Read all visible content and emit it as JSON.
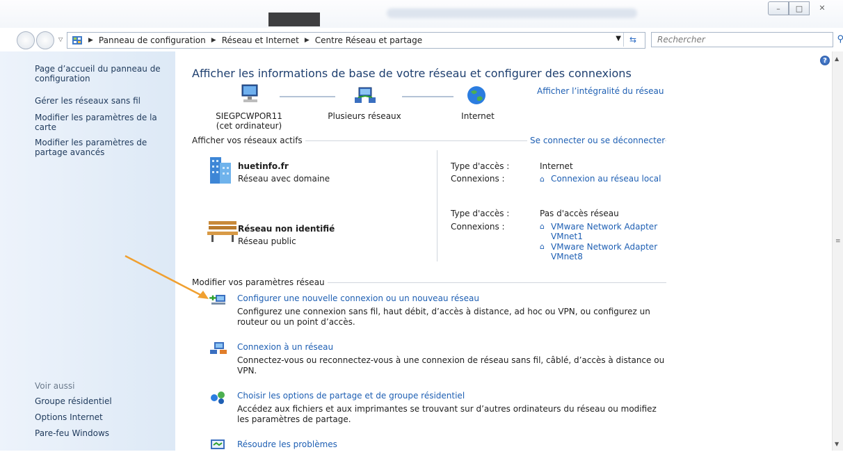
{
  "window": {
    "min_label": "–",
    "max_label": "□",
    "close_label": "✕"
  },
  "address": {
    "crumbs": [
      "Panneau de configuration",
      "Réseau et Internet",
      "Centre Réseau et partage"
    ],
    "search_placeholder": "Rechercher"
  },
  "sidebar": {
    "links": [
      "Page d’accueil du panneau de configuration",
      "Gérer les réseaux sans fil",
      "Modifier les paramètres de la carte",
      "Modifier les paramètres de partage avancés"
    ],
    "see_also_title": "Voir aussi",
    "see_also": [
      "Groupe résidentiel",
      "Options Internet",
      "Pare-feu Windows"
    ]
  },
  "main": {
    "heading": "Afficher les informations de base de votre réseau et configurer des connexions",
    "full_map_link": "Afficher l’intégralité du réseau",
    "map": {
      "computer": "SIEGPCWPOR11",
      "computer_sub": "(cet ordinateur)",
      "middle": "Plusieurs réseaux",
      "internet": "Internet"
    },
    "active_header": "Afficher vos réseaux actifs",
    "connect_link": "Se connecter ou se déconnecter",
    "networks": [
      {
        "name": "huetinfo.fr",
        "type": "Réseau avec domaine",
        "access_label": "Type d'accès :",
        "access_value": "Internet",
        "conn_label": "Connexions :",
        "connections": [
          "Connexion au réseau local"
        ]
      },
      {
        "name": "Réseau non identifié",
        "type": "Réseau public",
        "access_label": "Type d'accès :",
        "access_value": "Pas d'accès réseau",
        "conn_label": "Connexions :",
        "connections": [
          "VMware Network Adapter VMnet1",
          "VMware Network Adapter VMnet8"
        ]
      }
    ],
    "modify_header": "Modifier vos paramètres réseau",
    "tasks": [
      {
        "title": "Configurer une nouvelle connexion ou un nouveau réseau",
        "desc": "Configurez une connexion sans fil, haut débit, d’accès à distance, ad hoc ou VPN, ou configurez un routeur ou un point d’accès."
      },
      {
        "title": "Connexion à un réseau",
        "desc": "Connectez-vous ou reconnectez-vous à une connexion de réseau sans fil, câblé, d’accès à distance ou VPN."
      },
      {
        "title": "Choisir les options de partage et de groupe résidentiel",
        "desc": "Accédez aux fichiers et aux imprimantes se trouvant sur d’autres ordinateurs du réseau ou modifiez les paramètres de partage."
      },
      {
        "title": "Résoudre les problèmes",
        "desc": ""
      }
    ]
  },
  "colors": {
    "link": "#1e5fb3",
    "sidebar_bg": "#dde9f6",
    "heading": "#1e3f6f",
    "arrow": "#f0a030"
  },
  "help_label": "?"
}
